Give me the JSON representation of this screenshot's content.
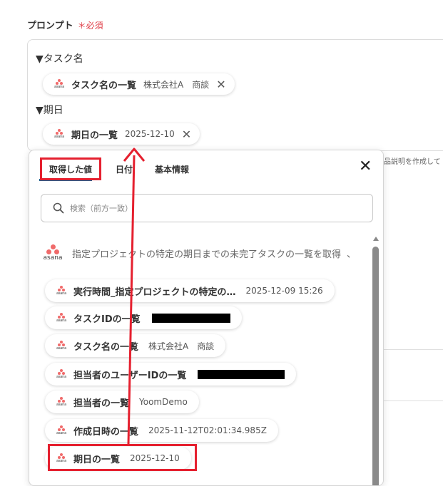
{
  "prompt": {
    "label": "プロンプト",
    "required": "＊必須",
    "sections": [
      {
        "head": "▼タスク名",
        "chip": {
          "label": "タスク名の一覧",
          "value": "株式会社A　商談"
        }
      },
      {
        "head": "▼期日",
        "chip": {
          "label": "期日の一覧",
          "value": "2025-12-10"
        }
      }
    ]
  },
  "side_text": "品説明を作成して",
  "dropdown": {
    "tabs": [
      "取得した値",
      "日付",
      "基本情報"
    ],
    "active_tab": 0,
    "search_placeholder": "検索（前方一致）",
    "group_title": "指定プロジェクトの特定の期日までの未完了タスクの一覧を取得",
    "group_trailing": "、",
    "items": [
      {
        "label": "実行時間_指定プロジェクトの特定の…",
        "value": "2025-12-09 15:26"
      },
      {
        "label": "タスクIDの一覧",
        "value": "",
        "redacted": true,
        "redact_width": 110
      },
      {
        "label": "タスク名の一覧",
        "value": "株式会社A　商談"
      },
      {
        "label": "担当者のユーザーIDの一覧",
        "value": "",
        "redacted": true,
        "redact_width": 122
      },
      {
        "label": "担当者の一覧",
        "value": "YoomDemo"
      },
      {
        "label": "作成日時の一覧",
        "value": "2025-11-12T02:01:34.985Z"
      },
      {
        "label": "期日の一覧",
        "value": "2025-12-10"
      }
    ]
  },
  "icons": {
    "asana": "asana-logo-icon",
    "close": "close-icon",
    "search": "search-icon"
  },
  "colors": {
    "accent_red": "#e5202f",
    "tab_underline": "#1d5c8a",
    "asana": "#f06a6a"
  }
}
